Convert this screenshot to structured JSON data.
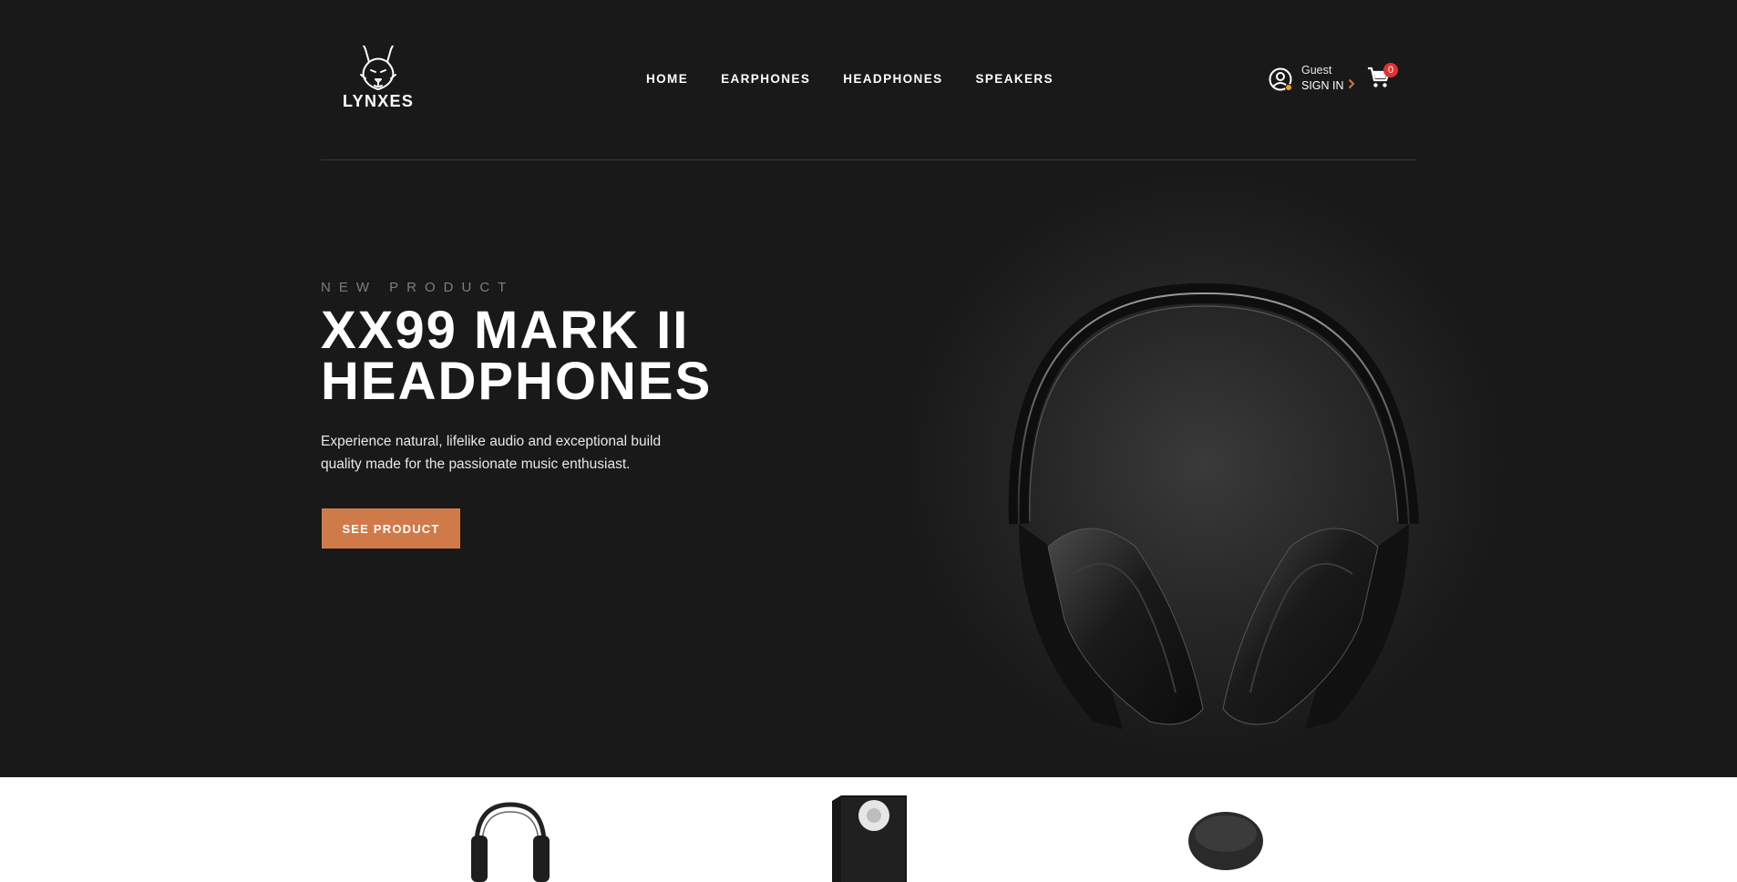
{
  "brand": {
    "name": "LYNXES",
    "logo_icon": "lynx-head-icon"
  },
  "nav": {
    "items": [
      {
        "label": "HOME"
      },
      {
        "label": "EARPHONES"
      },
      {
        "label": "HEADPHONES"
      },
      {
        "label": "SPEAKERS"
      }
    ]
  },
  "account": {
    "guest_label": "Guest",
    "signin_label": "SIGN IN",
    "status_color": "#f0a21a"
  },
  "cart": {
    "count": "0",
    "badge_color": "#e03131"
  },
  "hero": {
    "eyebrow": "NEW PRODUCT",
    "title": "XX99 MARK II HEADPHONES",
    "description": "Experience natural, lifelike audio and exceptional build quality made for the passionate music enthusiast.",
    "cta_label": "SEE PRODUCT",
    "cta_color": "#d07a4a",
    "background_color": "#191919",
    "image": "headphones-product-image"
  },
  "categories": {
    "thumbnails": [
      "headphones-thumbnail",
      "speaker-thumbnail",
      "earphones-thumbnail"
    ]
  }
}
